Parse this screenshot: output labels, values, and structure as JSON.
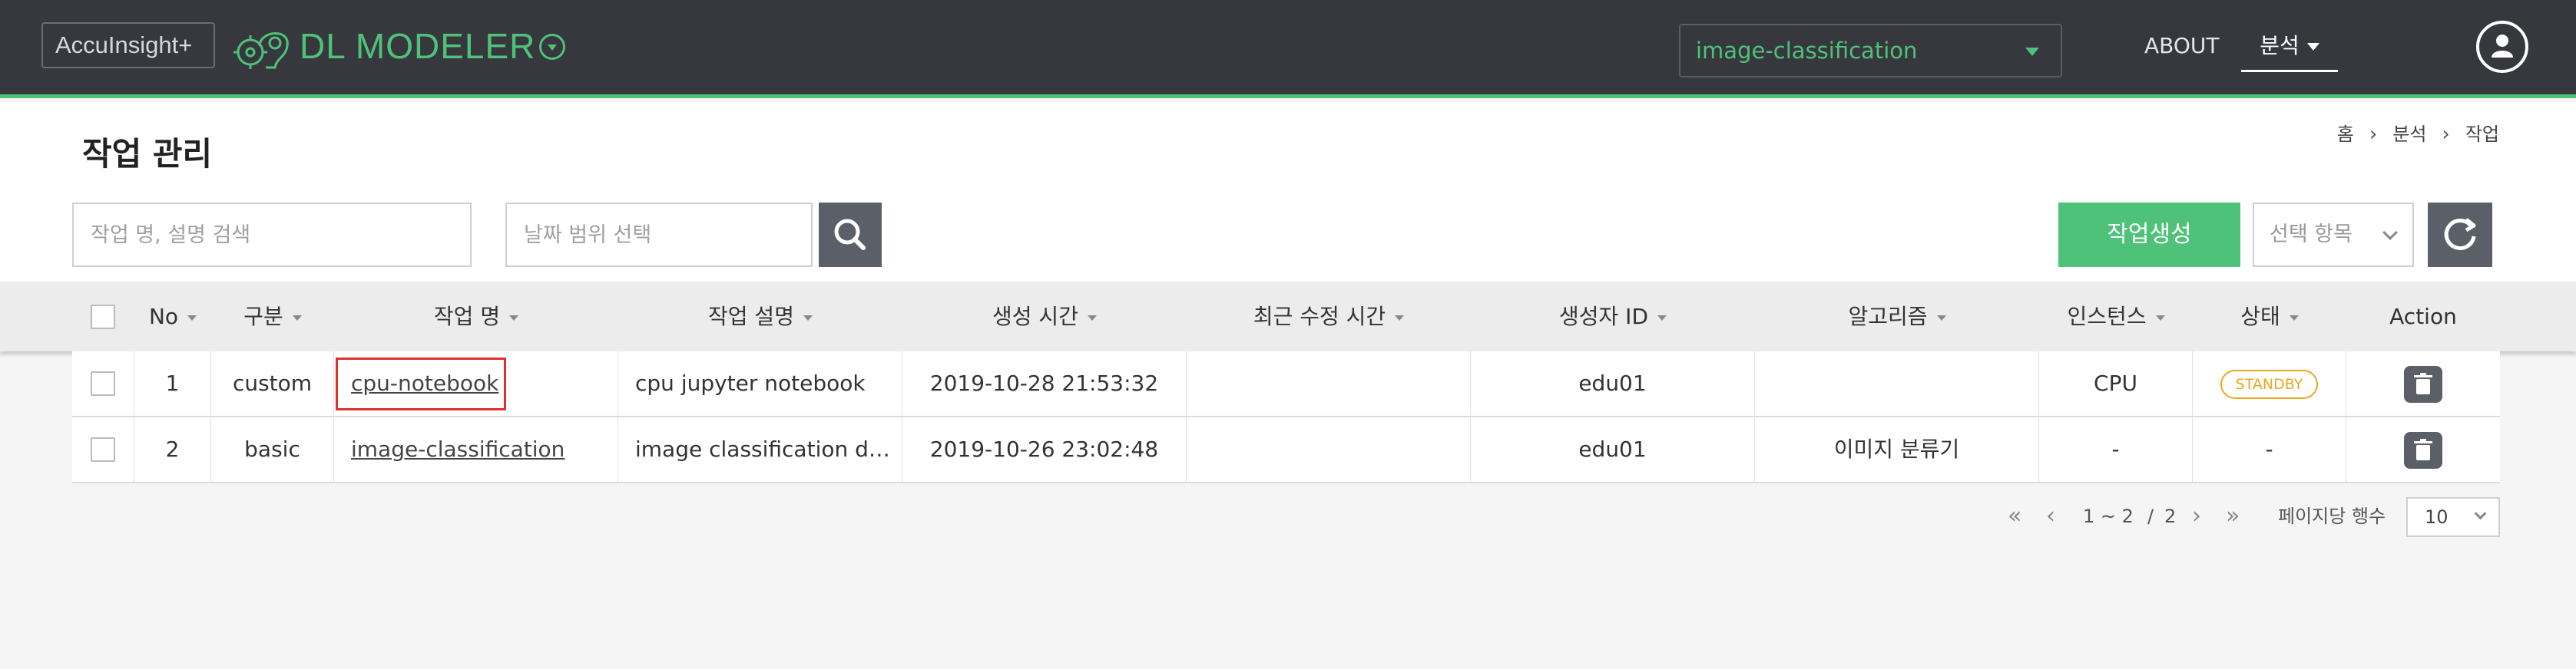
{
  "header": {
    "brand_name": "AccuInsight+",
    "product_title": "DL MODELER",
    "project_selected": "image-classification",
    "nav": {
      "about": "ABOUT",
      "analysis": "분석"
    }
  },
  "page": {
    "title": "작업 관리",
    "breadcrumb": [
      "홈",
      "분석",
      "작업"
    ]
  },
  "toolbar": {
    "search_placeholder": "작업 명, 설명 검색",
    "date_placeholder": "날짜 범위 선택",
    "create_label": "작업생성",
    "select_items_label": "선택 항목"
  },
  "table": {
    "columns": [
      "No",
      "구분",
      "작업 명",
      "작업 설명",
      "생성 시간",
      "최근 수정 시간",
      "생성자 ID",
      "알고리즘",
      "인스턴스",
      "상태",
      "Action"
    ],
    "rows": [
      {
        "no": "1",
        "type": "custom",
        "name": "cpu-notebook",
        "desc": "cpu jupyter notebook",
        "created": "2019-10-28 21:53:32",
        "modified": "",
        "creator": "edu01",
        "algorithm": "",
        "instance": "CPU",
        "status": "STANDBY"
      },
      {
        "no": "2",
        "type": "basic",
        "name": "image-classification",
        "desc": "image classification de···",
        "created": "2019-10-26 23:02:48",
        "modified": "",
        "creator": "edu01",
        "algorithm": "이미지 분류기",
        "instance": "-",
        "status": "-"
      }
    ]
  },
  "pagination": {
    "range": "1 ~ 2",
    "separator": "/",
    "total": "2",
    "rows_per_page_label": "페이지당 행수",
    "rows_per_page": "10"
  },
  "colors": {
    "accent": "#4fc27a",
    "header_bg": "#36383d",
    "status_standby": "#e6a91e",
    "highlight": "#e0302a"
  }
}
